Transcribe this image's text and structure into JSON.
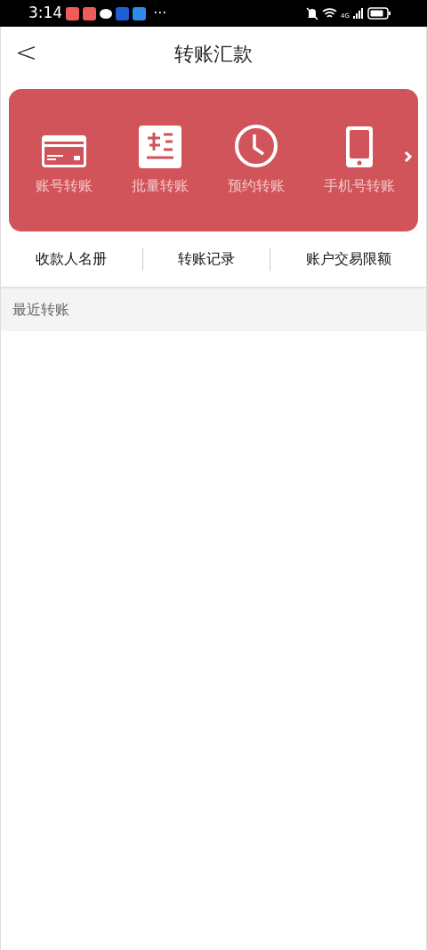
{
  "status_bar": {
    "time": "3:14",
    "more": "···",
    "network": "4G"
  },
  "header": {
    "back": "<",
    "title": "转账汇款"
  },
  "services": [
    {
      "label": "账号转账"
    },
    {
      "label": "批量转账"
    },
    {
      "label": "预约转账"
    },
    {
      "label": "手机号转账"
    }
  ],
  "links": [
    "收款人名册",
    "转账记录",
    "账户交易限额"
  ],
  "section": {
    "title": "最近转账"
  }
}
